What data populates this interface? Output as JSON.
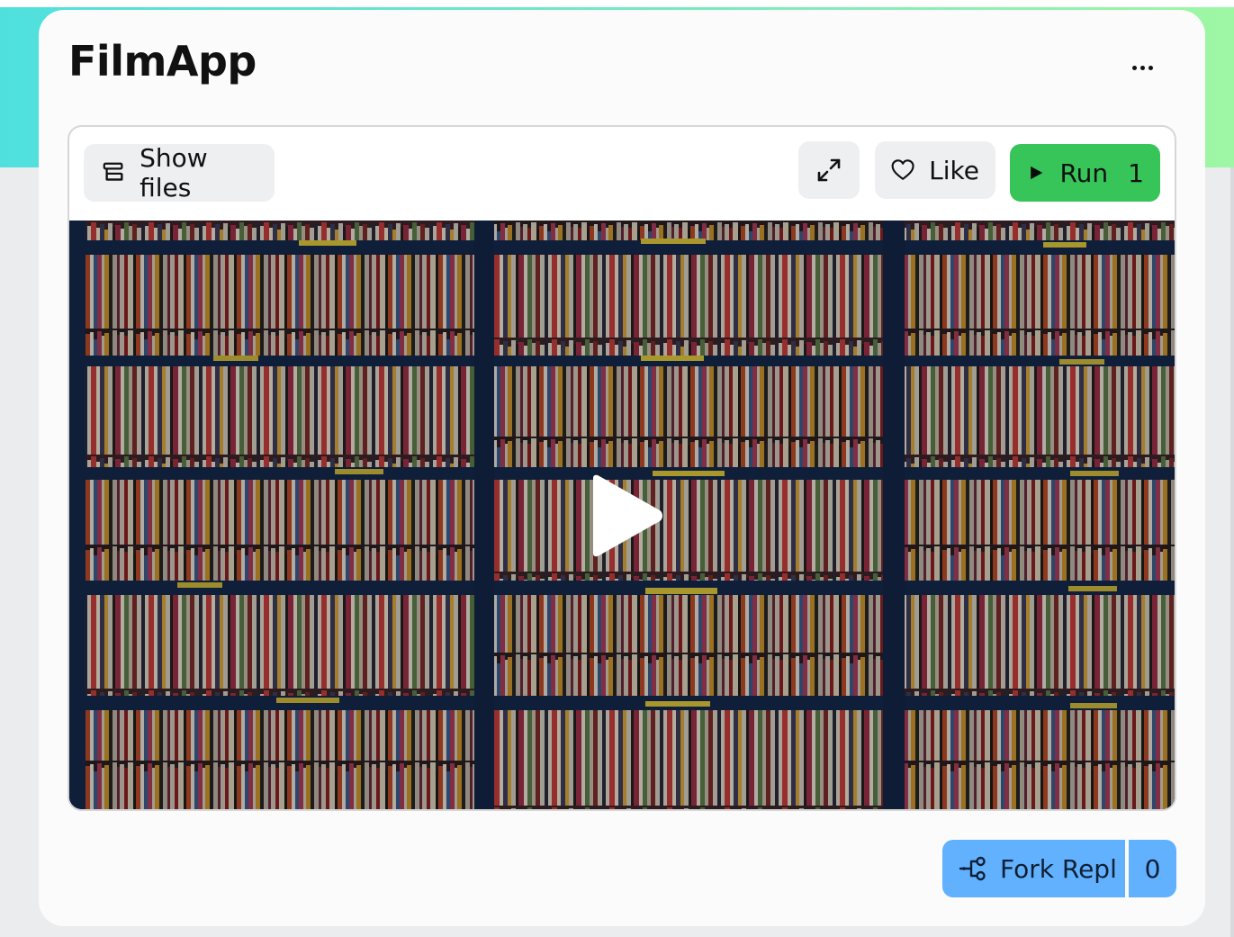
{
  "app": {
    "title": "FilmApp"
  },
  "menu": {
    "icon": "ellipsis-icon"
  },
  "toolbar": {
    "show_files_label": "Show files",
    "like_label": "Like",
    "run_label": "Run",
    "run_count": "1"
  },
  "fork": {
    "label": "Fork Repl",
    "count": "0"
  },
  "colors": {
    "gradient_start": "#4fe0de",
    "gradient_end": "#9ef7a3",
    "run_green": "#37c459",
    "fork_blue": "#62b1ff",
    "card_bg": "#fbfbfb",
    "page_bg": "#ebecee"
  }
}
